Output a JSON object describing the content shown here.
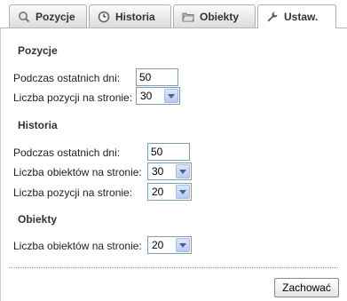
{
  "tabs": [
    {
      "label": "Pozycje",
      "icon": "search-icon",
      "active": false
    },
    {
      "label": "Historia",
      "icon": "clock-icon",
      "active": false
    },
    {
      "label": "Obiekty",
      "icon": "folder-icon",
      "active": false
    },
    {
      "label": "Ustaw.",
      "icon": "wrench-icon",
      "active": true
    }
  ],
  "pozycje": {
    "title": "Pozycje",
    "days_label": "Podczas ostatnich dni:",
    "days_value": "50",
    "per_page_label": "Liczba pozycji na stronie:",
    "per_page_value": "30"
  },
  "historia": {
    "title": "Historia",
    "days_label": "Podczas ostatnich dni:",
    "days_value": "50",
    "objects_per_page_label": "Liczba obiektów na stronie:",
    "objects_per_page_value": "30",
    "positions_per_page_label": "Liczba pozycji na stronie:",
    "positions_per_page_value": "20"
  },
  "obiekty": {
    "title": "Obiekty",
    "objects_per_page_label": "Liczba obiektów na stronie:",
    "objects_per_page_value": "20"
  },
  "save_label": "Zachować",
  "colors": {
    "input_border": "#7f9db9",
    "dropdown_button": "#c7d7f8"
  }
}
